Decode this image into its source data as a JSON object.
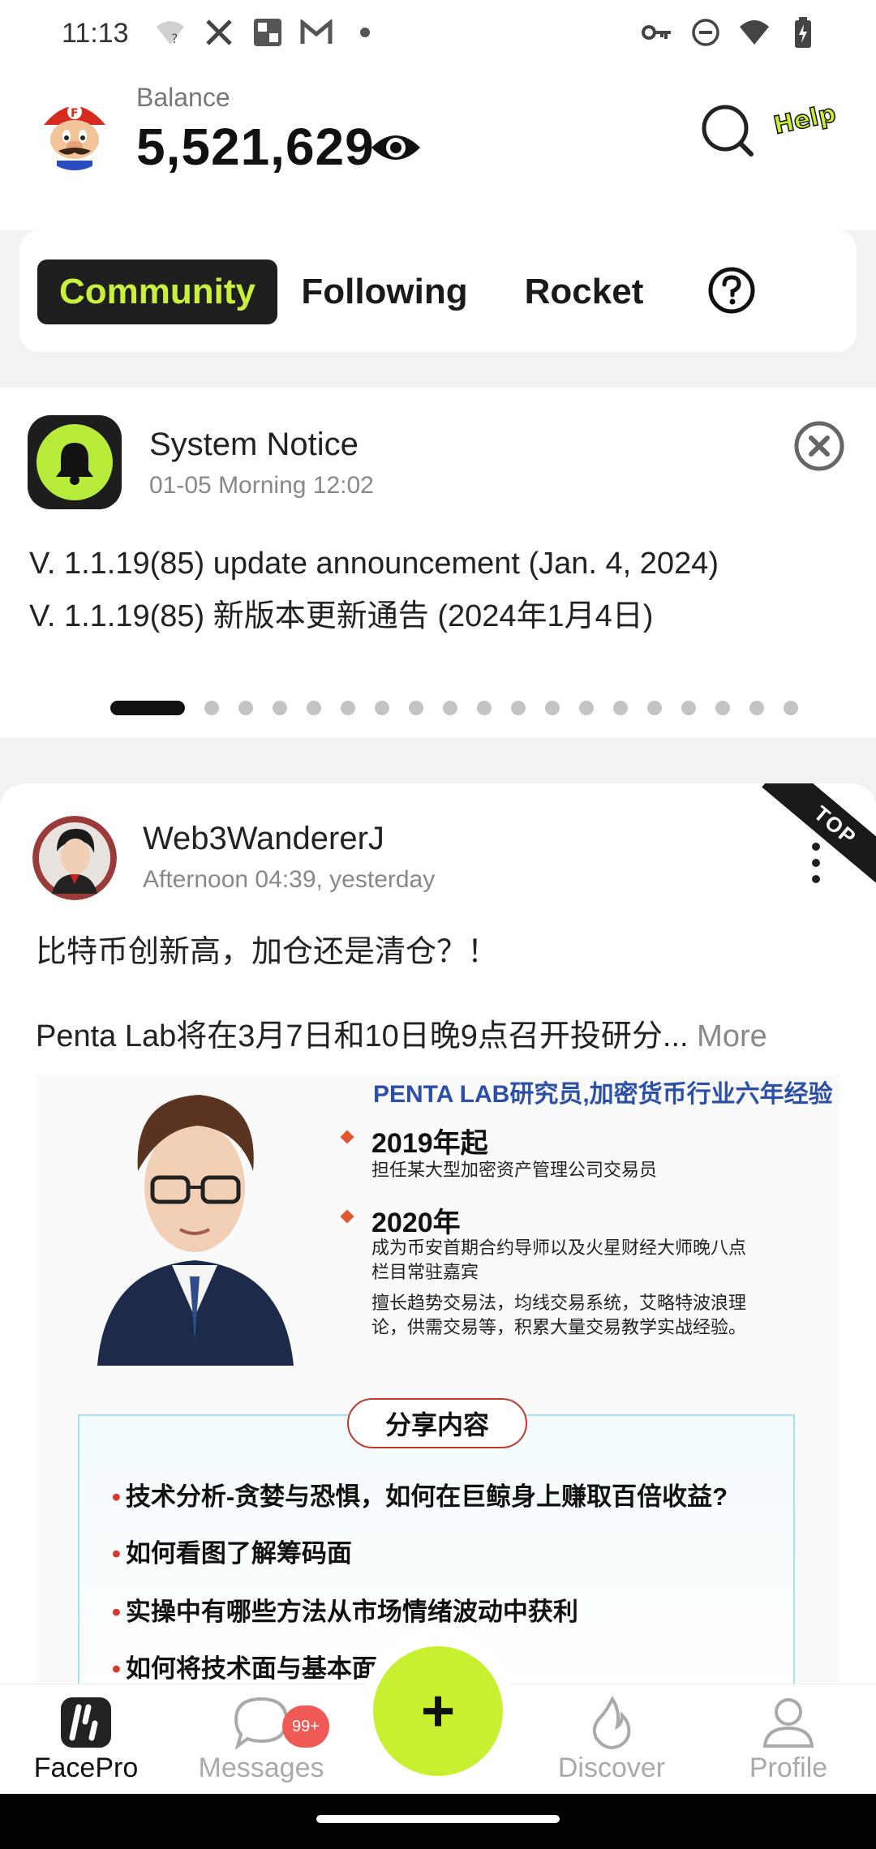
{
  "status_bar": {
    "time": "11:13",
    "left_icons": [
      "wifi-question-icon",
      "x-icon",
      "grid-app-icon",
      "gmail-icon",
      "dot-icon"
    ],
    "right_icons": [
      "key-icon",
      "dnd-icon",
      "wifi-icon",
      "battery-charging-icon"
    ]
  },
  "header": {
    "balance_label": "Balance",
    "balance_value": "5,521,629",
    "help_text": "Help ?"
  },
  "tabs": [
    {
      "label": "Community",
      "active": true
    },
    {
      "label": "Following",
      "active": false
    },
    {
      "label": "Rocket",
      "active": false
    }
  ],
  "notice": {
    "title": "System Notice",
    "time": "01-05 Morning 12:02",
    "lines": [
      "V. 1.1.19(85) update announcement (Jan. 4, 2024)",
      "V. 1.1.19(85) 新版本更新通告 (2024年1月4日)"
    ],
    "page_count": 19,
    "active_page": 1
  },
  "post": {
    "badge": "TOP",
    "user": "Web3WandererJ",
    "time": "Afternoon 04:39, yesterday",
    "line1": "比特币创新高，加仓还是清仓？！",
    "line2": "Penta Lab将在3月7日和10日晚9点召开投研分...",
    "more_label": "More",
    "poster": {
      "heading": "PENTA LAB研究员,加密货币行业六年经验",
      "year1": "2019年起",
      "year1_desc": "担任某大型加密资产管理公司交易员",
      "year2": "2020年",
      "year2_desc": "成为币安首期合约导师以及火星财经大师晚八点栏目常驻嘉宾",
      "skills": "擅长趋势交易法，均线交易系统，艾略特波浪理论，供需交易等，积累大量交易教学实战经验。",
      "share_title": "分享内容",
      "items": [
        "技术分析-贪婪与恐惧，如何在巨鲸身上赚取百倍收益?",
        "如何看图了解筹码面",
        "实操中有哪些方法从市场情绪波动中获利",
        "如何将技术面与基本面      益扩大"
      ]
    }
  },
  "bottom_nav": {
    "items": [
      {
        "label": "FacePro",
        "active": true
      },
      {
        "label": "Messages",
        "active": false
      },
      {
        "label": "Discover",
        "active": false
      },
      {
        "label": "Profile",
        "active": false
      }
    ],
    "messages_badge": "99+",
    "fab_symbol": "+"
  },
  "colors": {
    "accent": "#c6f030",
    "tab_active_bg": "#1f1f1f",
    "tab_active_text": "#c8f03c",
    "badge": "#f05a55"
  }
}
